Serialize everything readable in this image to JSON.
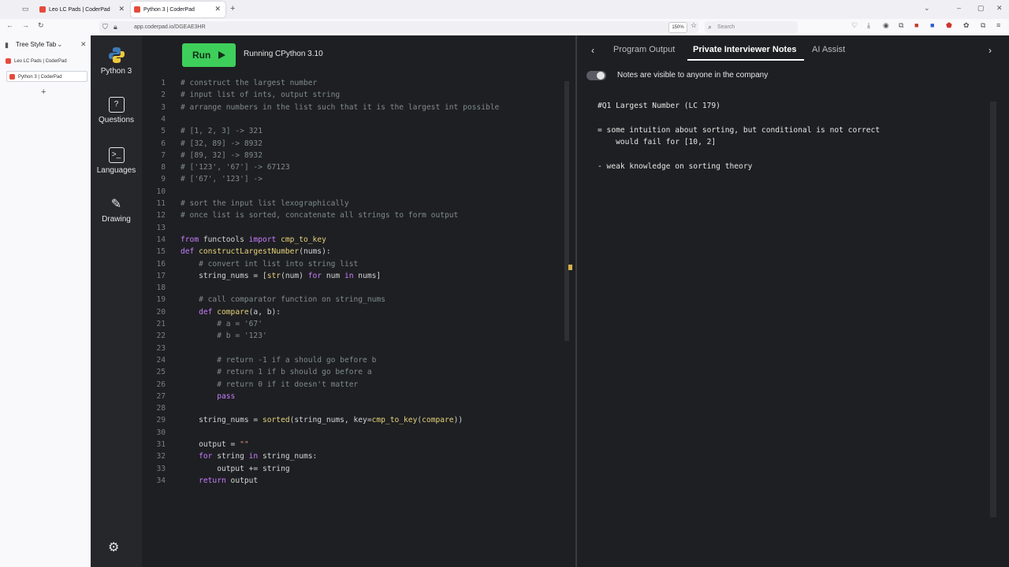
{
  "browser": {
    "tabs": [
      {
        "label": "Leo LC Pads | CoderPad",
        "active": false
      },
      {
        "label": "Python 3 | CoderPad",
        "active": true
      }
    ],
    "url": "app.coderpad.io/DGEAE3HR",
    "zoom": "150%",
    "search_placeholder": "Search"
  },
  "tree_sidebar": {
    "title": "Tree Style Tab",
    "items": [
      {
        "label": "Leo LC Pads | CoderPad",
        "selected": false
      },
      {
        "label": "Python 3 | CoderPad",
        "selected": true
      }
    ],
    "add_label": "+"
  },
  "nav": {
    "language": "Python 3",
    "questions": "Questions",
    "languages": "Languages",
    "drawing": "Drawing"
  },
  "editor": {
    "run_label": "Run",
    "status": "Running CPython 3.10",
    "lines": [
      {
        "n": "1",
        "text": "# construct the largest number"
      },
      {
        "n": "2",
        "text": "# input list of ints, output string"
      },
      {
        "n": "3",
        "text": "# arrange numbers in the list such that it is the largest int possible"
      },
      {
        "n": "4",
        "text": ""
      },
      {
        "n": "5",
        "text": "# [1, 2, 3] -> 321"
      },
      {
        "n": "6",
        "text": "# [32, 89] -> 8932"
      },
      {
        "n": "7",
        "text": "# [89, 32] -> 8932"
      },
      {
        "n": "8",
        "text": "# ['123', '67'] -> 67123"
      },
      {
        "n": "9",
        "text": "# ['67', '123'] ->"
      },
      {
        "n": "10",
        "text": ""
      },
      {
        "n": "11",
        "text": "# sort the input list lexographically"
      },
      {
        "n": "12",
        "text": "# once list is sorted, concatenate all strings to form output"
      },
      {
        "n": "13",
        "text": ""
      },
      {
        "n": "14",
        "text": "from functools import cmp_to_key"
      },
      {
        "n": "15",
        "text": "def constructLargestNumber(nums):"
      },
      {
        "n": "16",
        "text": "    # convert int list into string list"
      },
      {
        "n": "17",
        "text": "    string_nums = [str(num) for num in nums]"
      },
      {
        "n": "18",
        "text": ""
      },
      {
        "n": "19",
        "text": "    # call comparator function on string_nums"
      },
      {
        "n": "20",
        "text": "    def compare(a, b):"
      },
      {
        "n": "21",
        "text": "        # a = '67'"
      },
      {
        "n": "22",
        "text": "        # b = '123'"
      },
      {
        "n": "23",
        "text": ""
      },
      {
        "n": "24",
        "text": "        # return -1 if a should go before b"
      },
      {
        "n": "25",
        "text": "        # return 1 if b should go before a"
      },
      {
        "n": "26",
        "text": "        # return 0 if it doesn't matter"
      },
      {
        "n": "27",
        "text": "        pass"
      },
      {
        "n": "28",
        "text": ""
      },
      {
        "n": "29",
        "text": "    string_nums = sorted(string_nums, key=cmp_to_key(compare))"
      },
      {
        "n": "30",
        "text": ""
      },
      {
        "n": "31",
        "text": "    output = \"\""
      },
      {
        "n": "32",
        "text": "    for string in string_nums:"
      },
      {
        "n": "33",
        "text": "        output += string"
      },
      {
        "n": "34",
        "text": "    return output"
      }
    ]
  },
  "right_panel": {
    "tabs": [
      "Program Output",
      "Private Interviewer Notes",
      "AI Assist"
    ],
    "active_tab": "Private Interviewer Notes",
    "toggle_label": "Notes are visible to anyone in the company",
    "notes": [
      "#Q1 Largest Number (LC 179)",
      "",
      "= some intuition about sorting, but conditional is not correct",
      "    would fail for [10, 2]",
      "",
      "- weak knowledge on sorting theory"
    ]
  }
}
